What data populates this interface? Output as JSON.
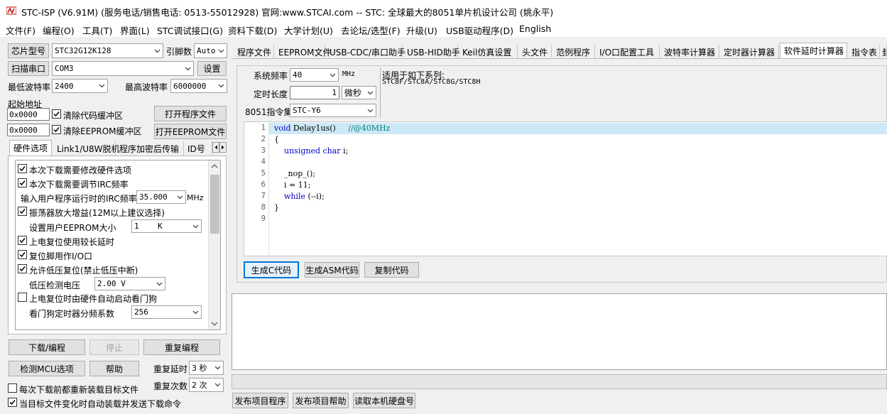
{
  "title": "STC-ISP (V6.91M) (服务电话/销售电话: 0513-55012928) 官网:www.STCAI.com  -- STC: 全球最大的8051单片机设计公司 (姚永平)",
  "menu": [
    "文件(F)",
    "编程(O)",
    "工具(T)",
    "界面(L)",
    "STC调试接口(G)",
    "资料下载(D)",
    "大学计划(U)",
    "去论坛/选型(F)",
    "升级(U)",
    "USB驱动程序(D)",
    "English"
  ],
  "left": {
    "chip_type_btn": "芯片型号",
    "chip_value": "STC32G12K128",
    "pin_label": "引脚数",
    "pin_value": "Auto",
    "scan_port_btn": "扫描串口",
    "port_value": "COM3",
    "settings_btn": "设置",
    "min_baud_label": "最低波特率",
    "min_baud_value": "2400",
    "max_baud_label": "最高波特率",
    "max_baud_value": "6000000",
    "start_addr_label": "起始地址",
    "addr1": "0x0000",
    "clear_code_label": "清除代码缓冲区",
    "open_prog_btn": "打开程序文件",
    "addr2": "0x0000",
    "clear_eeprom_label": "清除EEPROM缓冲区",
    "open_eeprom_btn": "打开EEPROM文件",
    "tabs": [
      "硬件选项",
      "Link1/U8W脱机",
      "程序加密后传输",
      "ID号"
    ],
    "options": {
      "opt1": "本次下载需要修改硬件选项",
      "opt2": "本次下载需要调节IRC频率",
      "irc_label": "输入用户程序运行时的IRC频率",
      "irc_value": "35.000",
      "irc_unit": "MHz",
      "opt3": "振荡器放大增益(12M以上建议选择)",
      "eeprom_size_label": "设置用户EEPROM大小",
      "eeprom_size_value": "1    K",
      "opt4": "上电复位使用较长延时",
      "opt5": "复位脚用作I/O口",
      "opt6": "允许低压复位(禁止低压中断)",
      "lvd_label": "低压检测电压",
      "lvd_value": "2.00 V",
      "opt7": "上电复位时由硬件自动启动看门狗",
      "wdt_label": "看门狗定时器分频系数",
      "wdt_value": "256"
    },
    "download_btn": "下载/编程",
    "stop_btn": "停止",
    "reprogram_btn": "重复编程",
    "check_mcu_btn": "检测MCU选项",
    "help_btn": "帮助",
    "repeat_delay_label": "重复延时",
    "repeat_delay_value": "3 秒",
    "repeat_count_label": "重复次数",
    "repeat_count_value": "2 次",
    "reload_label": "每次下载前都重新装载目标文件",
    "auto_label": "当目标文件变化时自动装载并发送下载命令"
  },
  "right": {
    "tabs": [
      "程序文件",
      "EEPROM文件",
      "USB-CDC/串口助手",
      "USB-HID助手",
      "Keil仿真设置",
      "头文件",
      "范例程序",
      "I/O口配置工具",
      "波特率计算器",
      "定时器计算器",
      "软件延时计算器",
      "指令表",
      "封"
    ],
    "sys_freq_label": "系统频率",
    "sys_freq_value": "40",
    "sys_freq_unit": "MHz",
    "timer_len_label": "定时长度",
    "timer_len_value": "1",
    "timer_unit": "微秒",
    "isa_label": "8051指令集",
    "isa_value": "STC-Y6",
    "series_label": "适用于如下系列:",
    "series_value": "STC8F/STC8A/STC8G/STC8H",
    "code_lines": [
      "void Delay1us()\t\t//@40MHz",
      "{",
      "\tunsigned char i;",
      "",
      "\t_nop_();",
      "\ti = 11;",
      "\twhile (--i);",
      "}",
      ""
    ],
    "gen_c_btn": "生成C代码",
    "gen_asm_btn": "生成ASM代码",
    "copy_btn": "复制代码",
    "publish_prog_btn": "发布项目程序",
    "publish_help_btn": "发布项目帮助",
    "read_disk_btn": "读取本机硬盘号"
  }
}
